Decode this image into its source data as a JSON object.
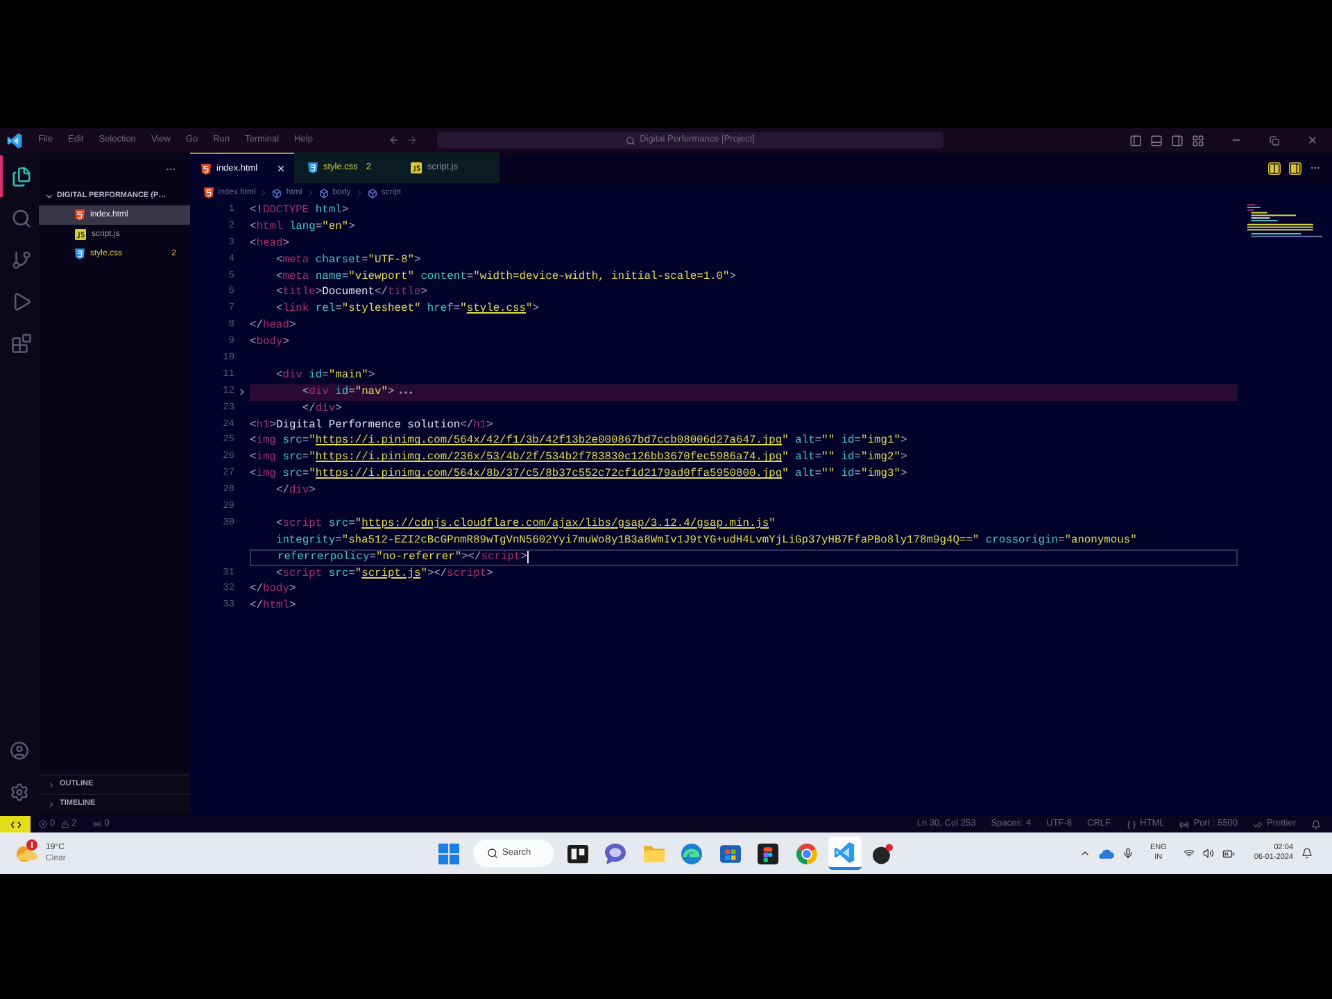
{
  "window": {
    "title": "Digital Performance [Project]",
    "menu": [
      "File",
      "Edit",
      "Selection",
      "View",
      "Go",
      "Run",
      "Terminal",
      "Help"
    ]
  },
  "activity_bar": [
    {
      "kind": "explorer",
      "selected": true
    },
    {
      "kind": "search",
      "selected": false
    },
    {
      "kind": "source-control",
      "selected": false
    },
    {
      "kind": "run",
      "selected": false
    },
    {
      "kind": "extensions",
      "selected": false
    }
  ],
  "sidebar": {
    "root": "DIGITAL PERFORMANCE (P…",
    "expanded": true,
    "files": [
      {
        "name": "index.html",
        "kind": "html",
        "selected": true
      },
      {
        "name": "script.js",
        "kind": "js",
        "selected": false
      },
      {
        "name": "style.css",
        "kind": "css",
        "selected": false,
        "badge": "2"
      }
    ],
    "sections": [
      {
        "label": "OUTLINE",
        "expanded": false
      },
      {
        "label": "TIMELINE",
        "expanded": false
      }
    ]
  },
  "tabs": [
    {
      "label": "index.html",
      "kind": "html",
      "selected": true
    },
    {
      "label": "style.css",
      "kind": "css",
      "badge": "2",
      "selected": false
    },
    {
      "label": "script.js",
      "kind": "js",
      "selected": false
    }
  ],
  "breadcrumb": [
    {
      "label": "index.html",
      "kind": "html"
    },
    {
      "label": "html",
      "kind": "element"
    },
    {
      "label": "body",
      "kind": "element"
    },
    {
      "label": "script",
      "kind": "element"
    }
  ],
  "editor": {
    "rows": [
      {
        "number": "1",
        "folded": false,
        "current": false,
        "tokens": [
          {
            "punct": "<!"
          },
          {
            "tag": "DOCTYPE"
          },
          {
            "attr": " html"
          },
          {
            "punct": ">"
          }
        ]
      },
      {
        "number": "2",
        "folded": false,
        "current": false,
        "tokens": [
          {
            "punct": "<"
          },
          {
            "tag": "html"
          },
          {
            "attr": " lang"
          },
          {
            "punct": "="
          },
          {
            "string": "\"en\""
          },
          {
            "punct": ">"
          }
        ]
      },
      {
        "number": "3",
        "folded": false,
        "current": false,
        "tokens": [
          {
            "punct": "<"
          },
          {
            "tag": "head"
          },
          {
            "punct": ">"
          }
        ]
      },
      {
        "number": "4",
        "folded": false,
        "current": false,
        "tokens": [
          {
            "punct": "    <"
          },
          {
            "tag": "meta"
          },
          {
            "attr": " charset"
          },
          {
            "punct": "="
          },
          {
            "string": "\"UTF-8\""
          },
          {
            "punct": ">"
          }
        ]
      },
      {
        "number": "5",
        "folded": false,
        "current": false,
        "tokens": [
          {
            "punct": "    <"
          },
          {
            "tag": "meta"
          },
          {
            "attr": " name"
          },
          {
            "punct": "="
          },
          {
            "string": "\"viewport\""
          },
          {
            "attr": " content"
          },
          {
            "punct": "="
          },
          {
            "string": "\"width=device-width, initial-scale=1.0\""
          },
          {
            "punct": ">"
          }
        ]
      },
      {
        "number": "6",
        "folded": false,
        "current": false,
        "tokens": [
          {
            "punct": "    <"
          },
          {
            "tag": "title"
          },
          {
            "punct": ">"
          },
          {
            "text": "Document"
          },
          {
            "punct": "</"
          },
          {
            "tag": "title"
          },
          {
            "punct": ">"
          }
        ]
      },
      {
        "number": "7",
        "folded": false,
        "current": false,
        "tokens": [
          {
            "punct": "    <"
          },
          {
            "tag": "link"
          },
          {
            "attr": " rel"
          },
          {
            "punct": "="
          },
          {
            "string": "\"stylesheet\""
          },
          {
            "attr": " href"
          },
          {
            "punct": "="
          },
          {
            "string": "\""
          },
          {
            "link": "style.css"
          },
          {
            "string": "\""
          },
          {
            "punct": ">"
          }
        ]
      },
      {
        "number": "8",
        "folded": false,
        "current": false,
        "tokens": [
          {
            "punct": "</"
          },
          {
            "tag": "head"
          },
          {
            "punct": ">"
          }
        ]
      },
      {
        "number": "9",
        "folded": false,
        "current": false,
        "tokens": [
          {
            "punct": "<"
          },
          {
            "tag": "body"
          },
          {
            "punct": ">"
          }
        ]
      },
      {
        "number": "10",
        "folded": false,
        "current": false,
        "tokens": []
      },
      {
        "number": "11",
        "folded": false,
        "current": false,
        "tokens": [
          {
            "punct": "    <"
          },
          {
            "tag": "div"
          },
          {
            "attr": " id"
          },
          {
            "punct": "="
          },
          {
            "string": "\"main\""
          },
          {
            "punct": ">"
          }
        ]
      },
      {
        "number": "12",
        "folded": true,
        "current": false,
        "tokens": [
          {
            "punct": "        <"
          },
          {
            "tag": "div"
          },
          {
            "attr": " id"
          },
          {
            "punct": "="
          },
          {
            "string": "\"nav\""
          },
          {
            "punct": ">"
          }
        ]
      },
      {
        "number": "23",
        "folded": false,
        "current": false,
        "tokens": [
          {
            "punct": "        </"
          },
          {
            "tag": "div"
          },
          {
            "punct": ">"
          }
        ]
      },
      {
        "number": "24",
        "folded": false,
        "current": false,
        "tokens": [
          {
            "punct": "<"
          },
          {
            "tag": "h1"
          },
          {
            "punct": ">"
          },
          {
            "text": "Digital Performence solution"
          },
          {
            "punct": "</"
          },
          {
            "tag": "h1"
          },
          {
            "punct": ">"
          }
        ]
      },
      {
        "number": "25",
        "folded": false,
        "current": false,
        "tokens": [
          {
            "punct": "<"
          },
          {
            "tag": "img"
          },
          {
            "attr": " src"
          },
          {
            "punct": "="
          },
          {
            "string": "\""
          },
          {
            "link": "https://i.pinimg.com/564x/42/f1/3b/42f13b2e000867bd7ccb08006d27a647.jpg"
          },
          {
            "string": "\""
          },
          {
            "attr": " alt"
          },
          {
            "punct": "="
          },
          {
            "string": "\"\""
          },
          {
            "attr": " id"
          },
          {
            "punct": "="
          },
          {
            "string": "\"img1\""
          },
          {
            "punct": ">"
          }
        ]
      },
      {
        "number": "26",
        "folded": false,
        "current": false,
        "tokens": [
          {
            "punct": "<"
          },
          {
            "tag": "img"
          },
          {
            "attr": " src"
          },
          {
            "punct": "="
          },
          {
            "string": "\""
          },
          {
            "link": "https://i.pinimg.com/236x/53/4b/2f/534b2f783830c126bb3670fec5986a74.jpg"
          },
          {
            "string": "\""
          },
          {
            "attr": " alt"
          },
          {
            "punct": "="
          },
          {
            "string": "\"\""
          },
          {
            "attr": " id"
          },
          {
            "punct": "="
          },
          {
            "string": "\"img2\""
          },
          {
            "punct": ">"
          }
        ]
      },
      {
        "number": "27",
        "folded": false,
        "current": false,
        "tokens": [
          {
            "punct": "<"
          },
          {
            "tag": "img"
          },
          {
            "attr": " src"
          },
          {
            "punct": "="
          },
          {
            "string": "\""
          },
          {
            "link": "https://i.pinimg.com/564x/8b/37/c5/8b37c552c72cf1d2179ad0ffa5950800.jpg"
          },
          {
            "string": "\""
          },
          {
            "attr": " alt"
          },
          {
            "punct": "="
          },
          {
            "string": "\"\""
          },
          {
            "attr": " id"
          },
          {
            "punct": "="
          },
          {
            "string": "\"img3\""
          },
          {
            "punct": ">"
          }
        ]
      },
      {
        "number": "28",
        "folded": false,
        "current": false,
        "tokens": [
          {
            "punct": "    </"
          },
          {
            "tag": "div"
          },
          {
            "punct": ">"
          }
        ]
      },
      {
        "number": "29",
        "folded": false,
        "current": false,
        "tokens": []
      },
      {
        "number": "30",
        "folded": false,
        "current": false,
        "tokens": [
          {
            "punct": "    <"
          },
          {
            "tag": "script"
          },
          {
            "attr": " src"
          },
          {
            "punct": "="
          },
          {
            "string": "\""
          },
          {
            "link": "https://cdnjs.cloudflare.com/ajax/libs/gsap/3.12.4/gsap.min.js"
          },
          {
            "string": "\""
          }
        ]
      },
      {
        "folded": false,
        "current": false,
        "tokens": [
          {
            "attr": "    integrity"
          },
          {
            "punct": "="
          },
          {
            "string": "\"sha512-EZI2cBcGPnmR89wTgVnN5602Yyi7muWo8y1B3a8WmIv1J9tYG+udH4LvmYjLiGp37yHB7FfaPBo8ly178m9g4Q==\""
          },
          {
            "attr": " crossorigin"
          },
          {
            "punct": "="
          },
          {
            "string": "\"anonymous\""
          }
        ]
      },
      {
        "folded": false,
        "current": true,
        "tokens": [
          {
            "attr": "    referrerpolicy"
          },
          {
            "punct": "="
          },
          {
            "string": "\"no-referrer\""
          },
          {
            "punct": "></"
          },
          {
            "tag": "script"
          },
          {
            "punct": ">"
          }
        ]
      },
      {
        "number": "31",
        "folded": false,
        "current": false,
        "tokens": [
          {
            "punct": "    <"
          },
          {
            "tag": "script"
          },
          {
            "attr": " src"
          },
          {
            "punct": "="
          },
          {
            "string": "\""
          },
          {
            "link": "script.js"
          },
          {
            "string": "\""
          },
          {
            "punct": "></"
          },
          {
            "tag": "script"
          },
          {
            "punct": ">"
          }
        ]
      },
      {
        "number": "32",
        "folded": false,
        "current": false,
        "tokens": [
          {
            "punct": "</"
          },
          {
            "tag": "body"
          },
          {
            "punct": ">"
          }
        ]
      },
      {
        "number": "33",
        "folded": false,
        "current": false,
        "tokens": [
          {
            "punct": "</"
          },
          {
            "tag": "html"
          },
          {
            "punct": ">"
          }
        ]
      }
    ]
  },
  "status_bar": {
    "errors": "0",
    "warnings": "2",
    "ports": "0",
    "items": [
      {
        "kind": "plain",
        "label": "Ln 30, Col 253"
      },
      {
        "kind": "plain",
        "label": "Spaces: 4"
      },
      {
        "kind": "plain",
        "label": "UTF-8"
      },
      {
        "kind": "plain",
        "label": "CRLF"
      },
      {
        "kind": "language",
        "label": "HTML"
      },
      {
        "kind": "port",
        "label": "Port : 5500"
      },
      {
        "kind": "check",
        "label": "Prettier"
      }
    ]
  },
  "taskbar": {
    "weather": {
      "temperature": "19°C",
      "condition": "Clear"
    },
    "search": {
      "placeholder": "Search"
    },
    "apps": [
      {
        "kind": "task-view",
        "selected": false
      },
      {
        "kind": "chat",
        "selected": false
      },
      {
        "kind": "folder",
        "selected": false
      },
      {
        "kind": "wave-browser",
        "selected": false
      },
      {
        "kind": "store",
        "selected": false
      },
      {
        "kind": "dark-tile",
        "selected": false
      },
      {
        "kind": "round-browser",
        "selected": false
      },
      {
        "kind": "code-editor",
        "selected": true
      },
      {
        "kind": "dark-ball",
        "selected": false
      }
    ],
    "language": [
      "ENG",
      "IN"
    ],
    "time": "02:04",
    "date": "06-01-2024"
  }
}
